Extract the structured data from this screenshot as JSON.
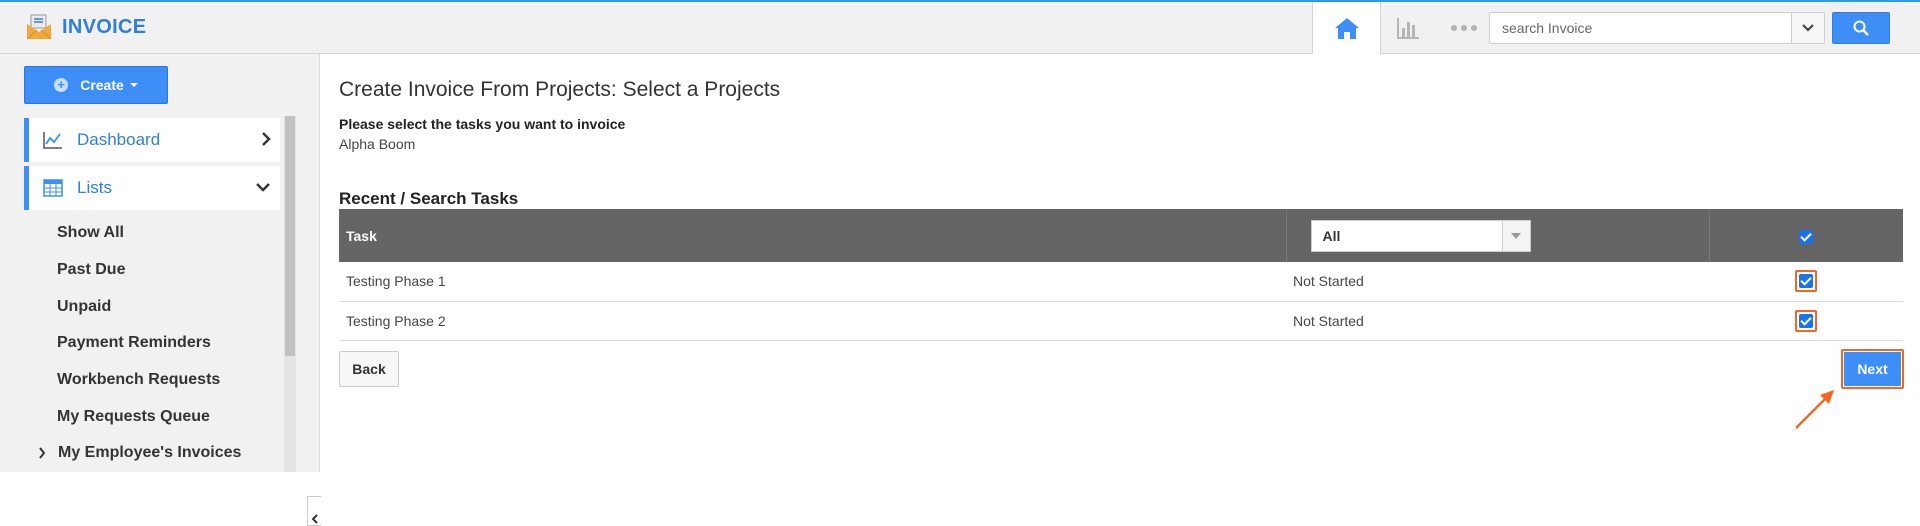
{
  "app": {
    "title": "INVOICE"
  },
  "header": {
    "search": {
      "placeholder": "search Invoice",
      "value": ""
    }
  },
  "sidebar": {
    "create_label": "Create",
    "nav": [
      {
        "label": "Dashboard",
        "icon": "line-chart-icon",
        "expanded": false
      },
      {
        "label": "Lists",
        "icon": "table-grid-icon",
        "expanded": true
      }
    ],
    "list_items": [
      "Show All",
      "Past Due",
      "Unpaid",
      "Payment Reminders",
      "Workbench Requests",
      "My Requests Queue"
    ],
    "expandable_item": "My Employee's Invoices"
  },
  "main": {
    "title": "Create Invoice From Projects: Select a Projects",
    "instructions": "Please select the tasks you want to invoice",
    "project": "Alpha Boom",
    "section_title": "Recent / Search Tasks",
    "table": {
      "header_task": "Task",
      "filter": {
        "selected": "All"
      },
      "header_checked": true,
      "rows": [
        {
          "task": "Testing Phase 1",
          "status": "Not Started",
          "checked": true
        },
        {
          "task": "Testing Phase 2",
          "status": "Not Started",
          "checked": true
        }
      ]
    },
    "back_label": "Back",
    "next_label": "Next"
  },
  "colors": {
    "accent": "#3e8ef7",
    "highlight": "#f26522",
    "table_header": "#656565"
  }
}
